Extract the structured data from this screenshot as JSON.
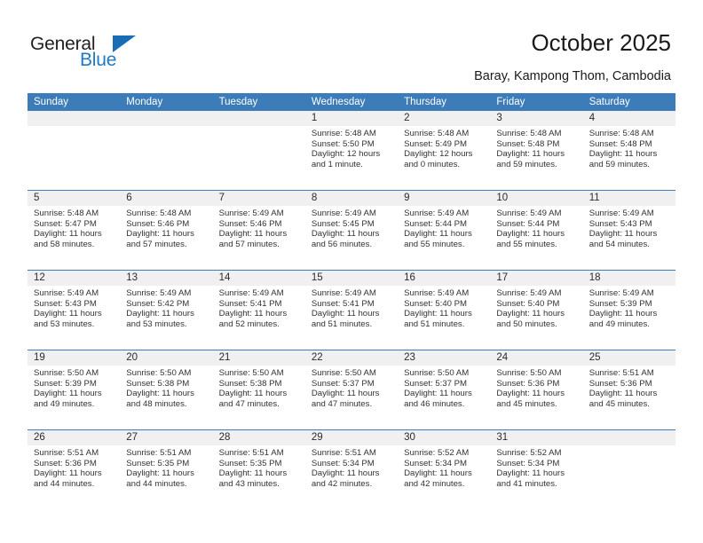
{
  "logo": {
    "word_one": "General",
    "word_two": "Blue",
    "triangle_color": "#1a6cb5"
  },
  "header": {
    "title": "October 2025",
    "location": "Baray, Kampong Thom, Cambodia"
  },
  "theme": {
    "header_blue": "#3b7cb9",
    "day_band_gray": "#f0f0f0",
    "text_dark": "#333333"
  },
  "weekdays": [
    "Sunday",
    "Monday",
    "Tuesday",
    "Wednesday",
    "Thursday",
    "Friday",
    "Saturday"
  ],
  "weeks": [
    [
      {
        "day": "",
        "empty": true
      },
      {
        "day": "",
        "empty": true
      },
      {
        "day": "",
        "empty": true
      },
      {
        "day": "1",
        "sunrise": "Sunrise: 5:48 AM",
        "sunset": "Sunset: 5:50 PM",
        "daylight_1": "Daylight: 12 hours",
        "daylight_2": "and 1 minute."
      },
      {
        "day": "2",
        "sunrise": "Sunrise: 5:48 AM",
        "sunset": "Sunset: 5:49 PM",
        "daylight_1": "Daylight: 12 hours",
        "daylight_2": "and 0 minutes."
      },
      {
        "day": "3",
        "sunrise": "Sunrise: 5:48 AM",
        "sunset": "Sunset: 5:48 PM",
        "daylight_1": "Daylight: 11 hours",
        "daylight_2": "and 59 minutes."
      },
      {
        "day": "4",
        "sunrise": "Sunrise: 5:48 AM",
        "sunset": "Sunset: 5:48 PM",
        "daylight_1": "Daylight: 11 hours",
        "daylight_2": "and 59 minutes."
      }
    ],
    [
      {
        "day": "5",
        "sunrise": "Sunrise: 5:48 AM",
        "sunset": "Sunset: 5:47 PM",
        "daylight_1": "Daylight: 11 hours",
        "daylight_2": "and 58 minutes."
      },
      {
        "day": "6",
        "sunrise": "Sunrise: 5:48 AM",
        "sunset": "Sunset: 5:46 PM",
        "daylight_1": "Daylight: 11 hours",
        "daylight_2": "and 57 minutes."
      },
      {
        "day": "7",
        "sunrise": "Sunrise: 5:49 AM",
        "sunset": "Sunset: 5:46 PM",
        "daylight_1": "Daylight: 11 hours",
        "daylight_2": "and 57 minutes."
      },
      {
        "day": "8",
        "sunrise": "Sunrise: 5:49 AM",
        "sunset": "Sunset: 5:45 PM",
        "daylight_1": "Daylight: 11 hours",
        "daylight_2": "and 56 minutes."
      },
      {
        "day": "9",
        "sunrise": "Sunrise: 5:49 AM",
        "sunset": "Sunset: 5:44 PM",
        "daylight_1": "Daylight: 11 hours",
        "daylight_2": "and 55 minutes."
      },
      {
        "day": "10",
        "sunrise": "Sunrise: 5:49 AM",
        "sunset": "Sunset: 5:44 PM",
        "daylight_1": "Daylight: 11 hours",
        "daylight_2": "and 55 minutes."
      },
      {
        "day": "11",
        "sunrise": "Sunrise: 5:49 AM",
        "sunset": "Sunset: 5:43 PM",
        "daylight_1": "Daylight: 11 hours",
        "daylight_2": "and 54 minutes."
      }
    ],
    [
      {
        "day": "12",
        "sunrise": "Sunrise: 5:49 AM",
        "sunset": "Sunset: 5:43 PM",
        "daylight_1": "Daylight: 11 hours",
        "daylight_2": "and 53 minutes."
      },
      {
        "day": "13",
        "sunrise": "Sunrise: 5:49 AM",
        "sunset": "Sunset: 5:42 PM",
        "daylight_1": "Daylight: 11 hours",
        "daylight_2": "and 53 minutes."
      },
      {
        "day": "14",
        "sunrise": "Sunrise: 5:49 AM",
        "sunset": "Sunset: 5:41 PM",
        "daylight_1": "Daylight: 11 hours",
        "daylight_2": "and 52 minutes."
      },
      {
        "day": "15",
        "sunrise": "Sunrise: 5:49 AM",
        "sunset": "Sunset: 5:41 PM",
        "daylight_1": "Daylight: 11 hours",
        "daylight_2": "and 51 minutes."
      },
      {
        "day": "16",
        "sunrise": "Sunrise: 5:49 AM",
        "sunset": "Sunset: 5:40 PM",
        "daylight_1": "Daylight: 11 hours",
        "daylight_2": "and 51 minutes."
      },
      {
        "day": "17",
        "sunrise": "Sunrise: 5:49 AM",
        "sunset": "Sunset: 5:40 PM",
        "daylight_1": "Daylight: 11 hours",
        "daylight_2": "and 50 minutes."
      },
      {
        "day": "18",
        "sunrise": "Sunrise: 5:49 AM",
        "sunset": "Sunset: 5:39 PM",
        "daylight_1": "Daylight: 11 hours",
        "daylight_2": "and 49 minutes."
      }
    ],
    [
      {
        "day": "19",
        "sunrise": "Sunrise: 5:50 AM",
        "sunset": "Sunset: 5:39 PM",
        "daylight_1": "Daylight: 11 hours",
        "daylight_2": "and 49 minutes."
      },
      {
        "day": "20",
        "sunrise": "Sunrise: 5:50 AM",
        "sunset": "Sunset: 5:38 PM",
        "daylight_1": "Daylight: 11 hours",
        "daylight_2": "and 48 minutes."
      },
      {
        "day": "21",
        "sunrise": "Sunrise: 5:50 AM",
        "sunset": "Sunset: 5:38 PM",
        "daylight_1": "Daylight: 11 hours",
        "daylight_2": "and 47 minutes."
      },
      {
        "day": "22",
        "sunrise": "Sunrise: 5:50 AM",
        "sunset": "Sunset: 5:37 PM",
        "daylight_1": "Daylight: 11 hours",
        "daylight_2": "and 47 minutes."
      },
      {
        "day": "23",
        "sunrise": "Sunrise: 5:50 AM",
        "sunset": "Sunset: 5:37 PM",
        "daylight_1": "Daylight: 11 hours",
        "daylight_2": "and 46 minutes."
      },
      {
        "day": "24",
        "sunrise": "Sunrise: 5:50 AM",
        "sunset": "Sunset: 5:36 PM",
        "daylight_1": "Daylight: 11 hours",
        "daylight_2": "and 45 minutes."
      },
      {
        "day": "25",
        "sunrise": "Sunrise: 5:51 AM",
        "sunset": "Sunset: 5:36 PM",
        "daylight_1": "Daylight: 11 hours",
        "daylight_2": "and 45 minutes."
      }
    ],
    [
      {
        "day": "26",
        "sunrise": "Sunrise: 5:51 AM",
        "sunset": "Sunset: 5:36 PM",
        "daylight_1": "Daylight: 11 hours",
        "daylight_2": "and 44 minutes."
      },
      {
        "day": "27",
        "sunrise": "Sunrise: 5:51 AM",
        "sunset": "Sunset: 5:35 PM",
        "daylight_1": "Daylight: 11 hours",
        "daylight_2": "and 44 minutes."
      },
      {
        "day": "28",
        "sunrise": "Sunrise: 5:51 AM",
        "sunset": "Sunset: 5:35 PM",
        "daylight_1": "Daylight: 11 hours",
        "daylight_2": "and 43 minutes."
      },
      {
        "day": "29",
        "sunrise": "Sunrise: 5:51 AM",
        "sunset": "Sunset: 5:34 PM",
        "daylight_1": "Daylight: 11 hours",
        "daylight_2": "and 42 minutes."
      },
      {
        "day": "30",
        "sunrise": "Sunrise: 5:52 AM",
        "sunset": "Sunset: 5:34 PM",
        "daylight_1": "Daylight: 11 hours",
        "daylight_2": "and 42 minutes."
      },
      {
        "day": "31",
        "sunrise": "Sunrise: 5:52 AM",
        "sunset": "Sunset: 5:34 PM",
        "daylight_1": "Daylight: 11 hours",
        "daylight_2": "and 41 minutes."
      },
      {
        "day": "",
        "empty": true
      }
    ]
  ]
}
